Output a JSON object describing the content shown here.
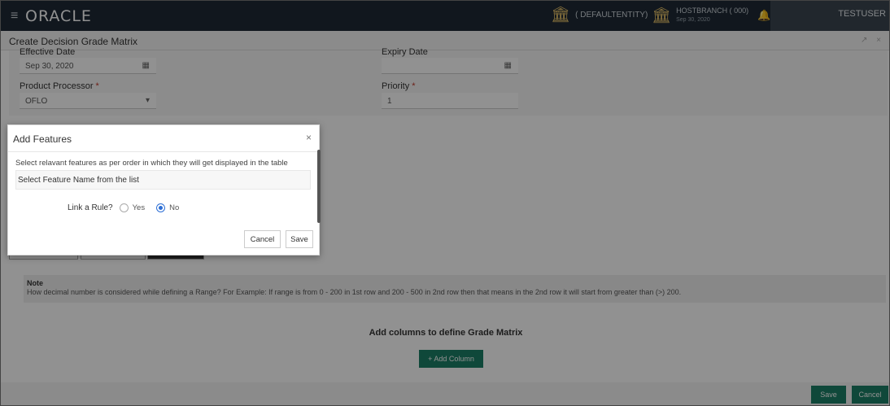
{
  "header": {
    "logo": "ORACLE",
    "menu_icon": "hamburger-icon",
    "entity": "( DEFAULTENTITY)",
    "branch_name": "HOSTBRANCH ( 000)",
    "branch_date": "Sep 30, 2020",
    "user": "TESTUSER"
  },
  "page": {
    "title": "Create Decision Grade Matrix",
    "window_icons": "↗ ×"
  },
  "form": {
    "effective_date_label": "Effective Date",
    "effective_date_value": "Sep 30, 2020",
    "expiry_date_label": "Expiry Date",
    "expiry_date_value": "",
    "product_processor_label": "Product Processor",
    "product_processor_value": "OFLO",
    "priority_label": "Priority",
    "priority_value": "1",
    "required_mark": "*"
  },
  "note": {
    "heading": "Note",
    "text": "How decimal number is considered while defining a Range? For Example: If range is from 0 - 200 in 1st row and 200 - 500 in 2nd row then that means in the 2nd row it will start from greater than (>) 200."
  },
  "matrix": {
    "heading": "Add columns to define Grade Matrix",
    "add_column_label": "+ Add Column"
  },
  "footer": {
    "save_label": "Save",
    "cancel_label": "Cancel"
  },
  "modal": {
    "title": "Add Features",
    "close": "×",
    "instruction": "Select relavant features as per order in which they will get displayed in the table",
    "select_placeholder": "Select Feature Name from the list",
    "rule_label": "Link a Rule?",
    "rule_options": [
      "Yes",
      "No"
    ],
    "rule_selected": "No",
    "cancel_label": "Cancel",
    "save_label": "Save"
  },
  "colors": {
    "header_bg": "#1e2a36",
    "accent_green": "#1b7f66",
    "radio_blue": "#2c6ed5",
    "bank_icon": "#e9c46a"
  }
}
